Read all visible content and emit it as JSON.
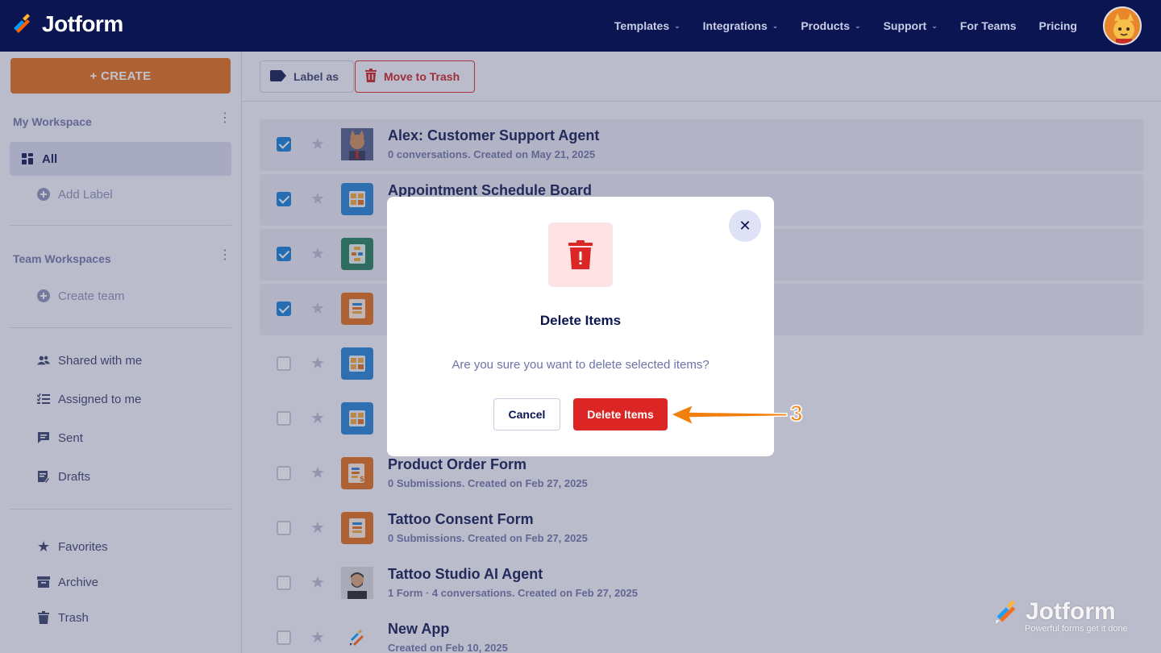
{
  "brand": {
    "name": "Jotform"
  },
  "nav": {
    "items": [
      {
        "label": "Templates",
        "has_dropdown": true
      },
      {
        "label": "Integrations",
        "has_dropdown": true
      },
      {
        "label": "Products",
        "has_dropdown": true
      },
      {
        "label": "Support",
        "has_dropdown": true
      },
      {
        "label": "For Teams",
        "has_dropdown": false
      },
      {
        "label": "Pricing",
        "has_dropdown": false
      }
    ]
  },
  "sidebar": {
    "create_label": "+ CREATE",
    "my_workspace": "My Workspace",
    "all_label": "All",
    "add_label": "Add Label",
    "team_workspaces": "Team Workspaces",
    "create_team": "Create team",
    "shared_with_me": "Shared with me",
    "assigned_to_me": "Assigned to me",
    "sent": "Sent",
    "drafts": "Drafts",
    "favorites": "Favorites",
    "archive": "Archive",
    "trash": "Trash"
  },
  "toolbar": {
    "label_as": "Label as",
    "move_to_trash": "Move to Trash"
  },
  "list": {
    "rows": [
      {
        "title": "Alex: Customer Support Agent",
        "subtitle": "0 conversations. Created on May 21, 2025",
        "checked": true
      },
      {
        "title": "Appointment Schedule Board",
        "subtitle": "",
        "checked": true
      },
      {
        "title": "",
        "subtitle": "",
        "checked": true
      },
      {
        "title": "",
        "subtitle": "",
        "checked": true
      },
      {
        "title": "",
        "subtitle": "",
        "checked": false
      },
      {
        "title": "",
        "subtitle": "",
        "checked": false
      },
      {
        "title": "Product Order Form",
        "subtitle": "0 Submissions. Created on Feb 27, 2025",
        "checked": false
      },
      {
        "title": "Tattoo Consent Form",
        "subtitle": "0 Submissions. Created on Feb 27, 2025",
        "checked": false
      },
      {
        "title": "Tattoo Studio AI Agent",
        "subtitle": "1 Form · 4 conversations. Created on Feb 27, 2025",
        "checked": false
      },
      {
        "title": "New App",
        "subtitle": "Created on Feb 10, 2025",
        "checked": false
      }
    ]
  },
  "modal": {
    "title": "Delete Items",
    "message": "Are you sure you want to delete selected items?",
    "cancel_label": "Cancel",
    "delete_label": "Delete Items",
    "close_icon": "close-icon"
  },
  "annotation": {
    "step": "3"
  },
  "watermark": {
    "name": "Jotform",
    "tagline": "Powerful forms get it done"
  },
  "colors": {
    "navy": "#0a1551",
    "orange": "#e16b16",
    "danger": "#dc2626",
    "checkbox_blue": "#0f7bd9"
  }
}
